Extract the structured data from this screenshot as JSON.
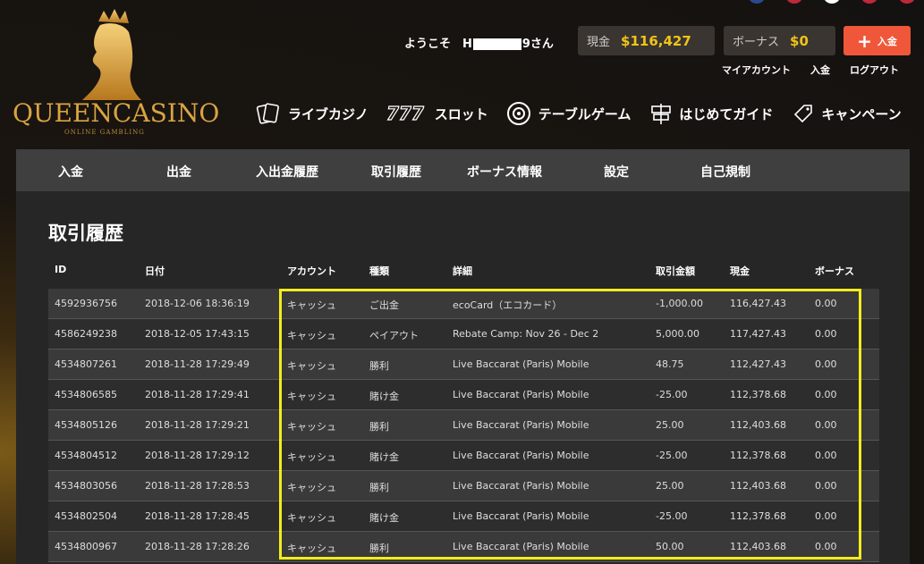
{
  "header": {
    "logo_text": "QUEENCASINO",
    "logo_sub": "ONLINE GAMBLING",
    "welcome_prefix": "ようこそ　H",
    "welcome_suffix": "9さん",
    "cash_label": "現金",
    "cash_value": "$116,427",
    "bonus_label": "ボーナス",
    "bonus_value": "$0",
    "deposit_label": "入金",
    "links": [
      "マイアカウント",
      "入金",
      "ログアウト"
    ]
  },
  "nav": [
    {
      "label": "ライブカジノ",
      "icon": "cards-icon"
    },
    {
      "label": "スロット",
      "icon": "777-icon"
    },
    {
      "label": "テーブルゲーム",
      "icon": "roulette-icon"
    },
    {
      "label": "はじめてガイド",
      "icon": "signpost-icon"
    },
    {
      "label": "キャンペーン",
      "icon": "tag-icon"
    }
  ],
  "tabs": [
    "入金",
    "出金",
    "入出金履歴",
    "取引履歴",
    "ボーナス情報",
    "設定",
    "自己規制"
  ],
  "page_title": "取引履歴",
  "table": {
    "headers": [
      "ID",
      "日付",
      "アカウント",
      "種類",
      "詳細",
      "取引金額",
      "現金",
      "ボーナス"
    ],
    "rows": [
      [
        "4592936756",
        "2018-12-06 18:36:19",
        "キャッシュ",
        "ご出金",
        "ecoCard（エコカード）",
        "-1,000.00",
        "116,427.43",
        "0.00"
      ],
      [
        "4586249238",
        "2018-12-05 17:43:15",
        "キャッシュ",
        "ペイアウト",
        "Rebate Camp: Nov 26 - Dec 2",
        "5,000.00",
        "117,427.43",
        "0.00"
      ],
      [
        "4534807261",
        "2018-11-28 17:29:49",
        "キャッシュ",
        "勝利",
        "Live Baccarat (Paris) Mobile",
        "48.75",
        "112,427.43",
        "0.00"
      ],
      [
        "4534806585",
        "2018-11-28 17:29:41",
        "キャッシュ",
        "賭け金",
        "Live Baccarat (Paris) Mobile",
        "-25.00",
        "112,378.68",
        "0.00"
      ],
      [
        "4534805126",
        "2018-11-28 17:29:21",
        "キャッシュ",
        "勝利",
        "Live Baccarat (Paris) Mobile",
        "25.00",
        "112,403.68",
        "0.00"
      ],
      [
        "4534804512",
        "2018-11-28 17:29:12",
        "キャッシュ",
        "賭け金",
        "Live Baccarat (Paris) Mobile",
        "-25.00",
        "112,378.68",
        "0.00"
      ],
      [
        "4534803056",
        "2018-11-28 17:28:53",
        "キャッシュ",
        "勝利",
        "Live Baccarat (Paris) Mobile",
        "25.00",
        "112,403.68",
        "0.00"
      ],
      [
        "4534802504",
        "2018-11-28 17:28:45",
        "キャッシュ",
        "賭け金",
        "Live Baccarat (Paris) Mobile",
        "-25.00",
        "112,378.68",
        "0.00"
      ],
      [
        "4534800967",
        "2018-11-28 17:28:26",
        "キャッシュ",
        "勝利",
        "Live Baccarat (Paris) Mobile",
        "50.00",
        "112,403.68",
        "0.00"
      ]
    ]
  },
  "colors": {
    "accent": "#f0c419",
    "deposit": "#f0573a",
    "highlight": "#f4ec1a"
  }
}
